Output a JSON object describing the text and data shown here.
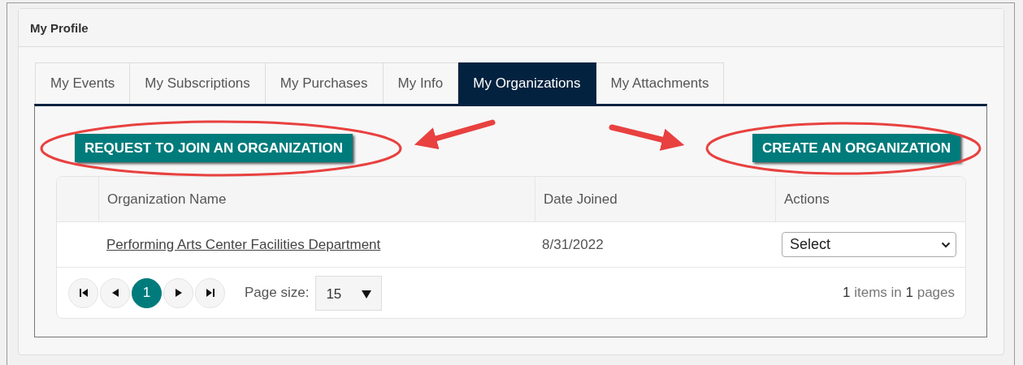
{
  "panel": {
    "title": "My Profile"
  },
  "tabs": [
    {
      "label": "My Events",
      "selected": false
    },
    {
      "label": "My Subscriptions",
      "selected": false
    },
    {
      "label": "My Purchases",
      "selected": false
    },
    {
      "label": "My Info",
      "selected": false
    },
    {
      "label": "My Organizations",
      "selected": true
    },
    {
      "label": "My Attachments",
      "selected": false
    }
  ],
  "actions": {
    "join_button": "REQUEST TO JOIN AN ORGANIZATION",
    "create_button": "CREATE AN ORGANIZATION"
  },
  "table": {
    "columns": [
      "Organization Name",
      "Date Joined",
      "Actions"
    ],
    "rows": [
      {
        "name": "Performing Arts Center Facilities Department",
        "date": "8/31/2022",
        "action": "Select"
      }
    ]
  },
  "pager": {
    "pages": [
      {
        "label": "1",
        "selected": true
      }
    ],
    "page_size_label": "Page size:",
    "page_size": "15",
    "summary": "**1** items in **1** pages"
  }
}
